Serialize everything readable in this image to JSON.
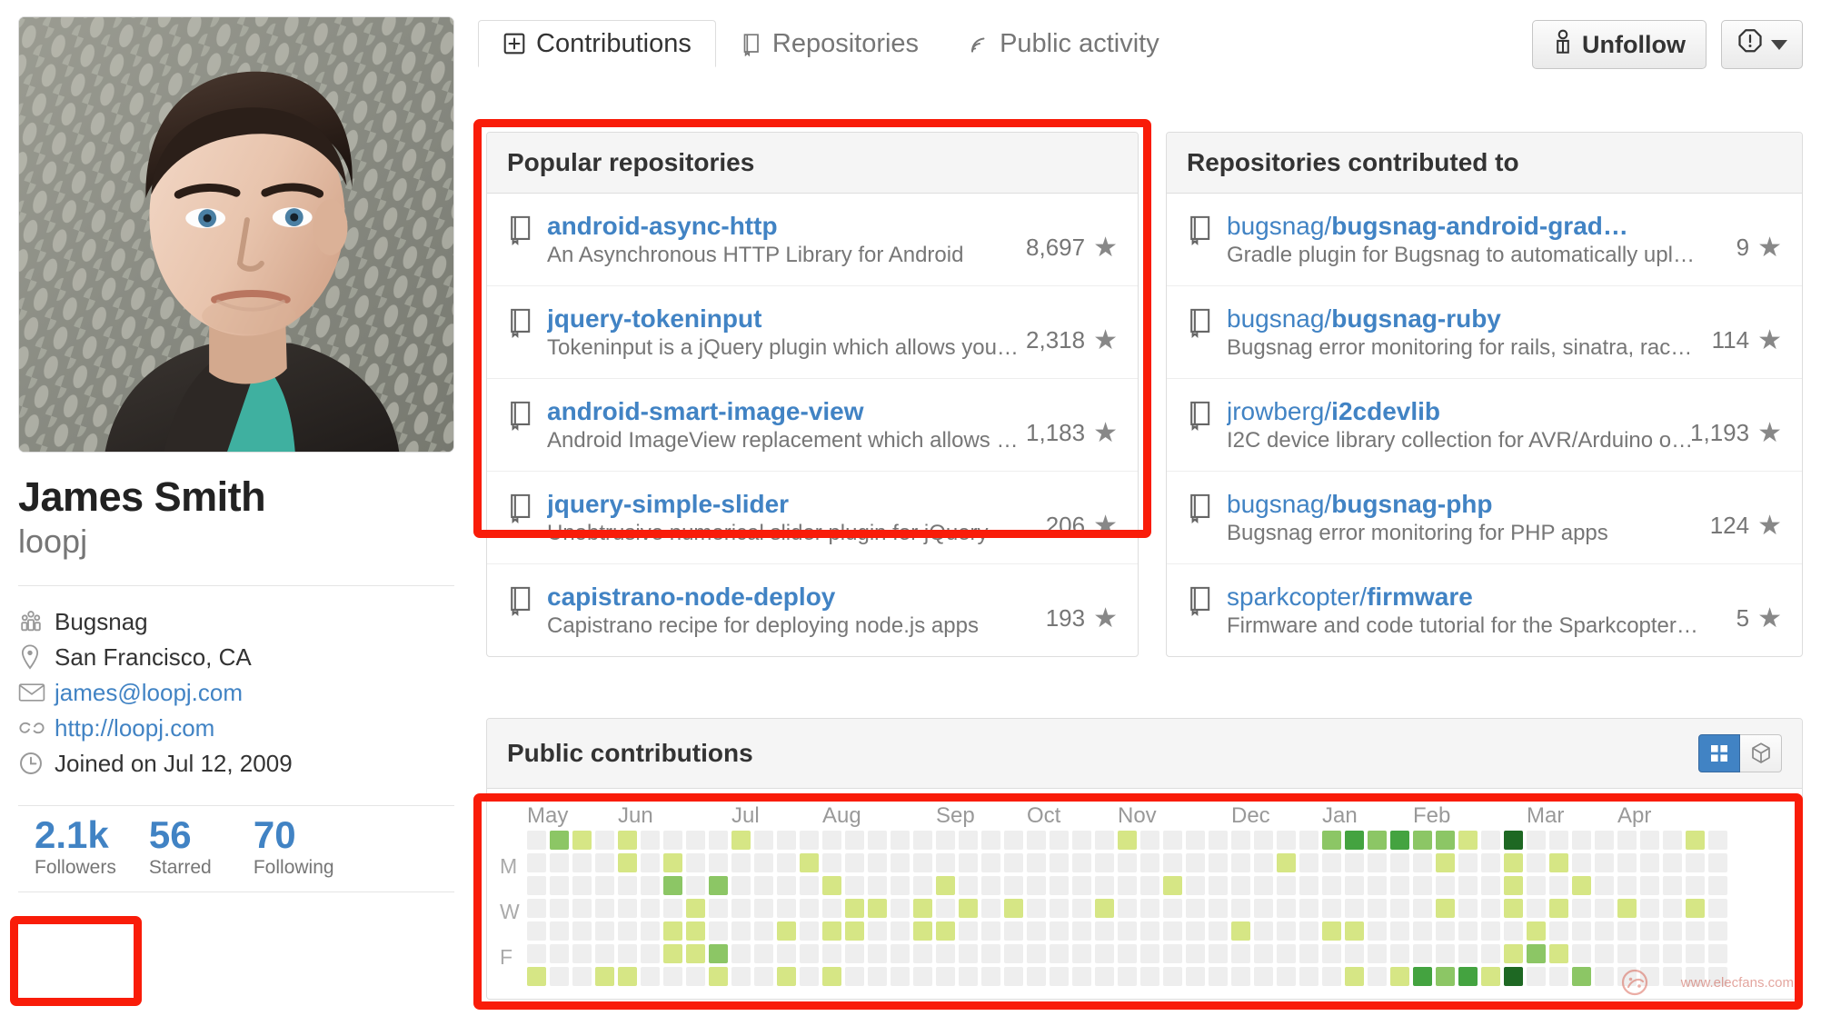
{
  "profile": {
    "avatar_alt": "avatar-photo",
    "fullname": "James Smith",
    "username": "loopj",
    "info": [
      {
        "icon": "organization-icon",
        "text": "Bugsnag",
        "link": false
      },
      {
        "icon": "location-pin-icon",
        "text": "San Francisco, CA",
        "link": false
      },
      {
        "icon": "mail-icon",
        "text": "james@loopj.com",
        "link": true
      },
      {
        "icon": "link-icon",
        "text": "http://loopj.com",
        "link": true
      },
      {
        "icon": "clock-icon",
        "text": "Joined on Jul 12, 2009",
        "link": false
      }
    ],
    "stats": [
      {
        "value": "2.1k",
        "label": "Followers"
      },
      {
        "value": "56",
        "label": "Starred"
      },
      {
        "value": "70",
        "label": "Following"
      }
    ]
  },
  "tabs": [
    {
      "label": "Contributions",
      "icon": "contributions-grid-icon",
      "active": true
    },
    {
      "label": "Repositories",
      "icon": "repo-book-icon",
      "active": false
    },
    {
      "label": "Public activity",
      "icon": "rss-feed-icon",
      "active": false
    }
  ],
  "actions": {
    "unfollow_label": "Unfollow",
    "unfollow_icon": "person-icon",
    "report_icon": "alert-octagon-icon",
    "report_caret": "chevron-down-icon"
  },
  "popular_repositories": {
    "title": "Popular repositories",
    "items": [
      {
        "owner": "",
        "name": "android-async-http",
        "description": "An Asynchronous HTTP Library for Android",
        "stars": "8,697"
      },
      {
        "owner": "",
        "name": "jquery-tokeninput",
        "description": "Tokeninput is a jQuery plugin which allows you…",
        "stars": "2,318"
      },
      {
        "owner": "",
        "name": "android-smart-image-view",
        "description": "Android ImageView replacement which allows …",
        "stars": "1,183"
      },
      {
        "owner": "",
        "name": "jquery-simple-slider",
        "description": "Unobtrusive numerical slider plugin for jQuery",
        "stars": "206"
      },
      {
        "owner": "",
        "name": "capistrano-node-deploy",
        "description": "Capistrano recipe for deploying node.js apps",
        "stars": "193"
      }
    ]
  },
  "contributed_repositories": {
    "title": "Repositories contributed to",
    "items": [
      {
        "owner": "bugsnag/",
        "name": "bugsnag-android-grad…",
        "description": "Gradle plugin for Bugsnag to automatically upl…",
        "stars": "9"
      },
      {
        "owner": "bugsnag/",
        "name": "bugsnag-ruby",
        "description": "Bugsnag error monitoring for rails, sinatra, rac…",
        "stars": "114"
      },
      {
        "owner": "jrowberg/",
        "name": "i2cdevlib",
        "description": "I2C device library collection for AVR/Arduino o…",
        "stars": "1,193"
      },
      {
        "owner": "bugsnag/",
        "name": "bugsnag-php",
        "description": "Bugsnag error monitoring for PHP apps",
        "stars": "124"
      },
      {
        "owner": "sparkcopter/",
        "name": "firmware",
        "description": "Firmware and code tutorial for the Sparkcopter…",
        "stars": "5"
      }
    ]
  },
  "public_contributions": {
    "title": "Public contributions",
    "view_toggle": [
      {
        "icon": "calendar-grid-icon",
        "active": true
      },
      {
        "icon": "cube-3d-icon",
        "active": false
      }
    ],
    "months": [
      "May",
      "Jun",
      "Jul",
      "Aug",
      "Sep",
      "Oct",
      "Nov",
      "Dec",
      "Jan",
      "Feb",
      "Mar",
      "Apr"
    ],
    "day_labels": [
      "M",
      "W",
      "F"
    ],
    "legend_colors": [
      "#eeeeee",
      "#d6e685",
      "#8cc665",
      "#44a340",
      "#1e6823"
    ]
  },
  "colors": {
    "accent_blue": "#4183c4",
    "annotation_red": "#f91c09",
    "text_dark": "#333333",
    "text_muted": "#767676"
  },
  "chart_data": {
    "type": "heatmap",
    "title": "Public contributions",
    "xlabel": "",
    "ylabel": "",
    "month_labels": [
      "May",
      "Jun",
      "Jul",
      "Aug",
      "Sep",
      "Oct",
      "Nov",
      "Dec",
      "Jan",
      "Feb",
      "Mar",
      "Apr"
    ],
    "month_start_weeks": [
      0,
      4,
      9,
      13,
      18,
      22,
      26,
      31,
      35,
      39,
      44,
      48
    ],
    "day_labels": [
      "",
      "M",
      "",
      "W",
      "",
      "F",
      ""
    ],
    "weeks": 53,
    "days_per_week": 7,
    "levels": [
      0,
      1,
      2,
      3,
      4
    ],
    "level_colors": [
      "#eeeeee",
      "#d6e685",
      "#8cc665",
      "#44a340",
      "#1e6823"
    ],
    "matrix": [
      [
        0,
        0,
        0,
        0,
        0,
        0,
        1
      ],
      [
        2,
        0,
        0,
        0,
        0,
        0,
        0
      ],
      [
        1,
        0,
        0,
        0,
        0,
        0,
        0
      ],
      [
        0,
        0,
        0,
        0,
        0,
        0,
        1
      ],
      [
        1,
        1,
        0,
        0,
        0,
        0,
        1
      ],
      [
        0,
        0,
        0,
        0,
        0,
        0,
        0
      ],
      [
        0,
        1,
        2,
        0,
        1,
        1,
        0
      ],
      [
        0,
        0,
        0,
        1,
        1,
        1,
        0
      ],
      [
        0,
        0,
        2,
        0,
        0,
        2,
        1
      ],
      [
        1,
        0,
        0,
        0,
        0,
        0,
        0
      ],
      [
        0,
        0,
        0,
        0,
        0,
        0,
        0
      ],
      [
        0,
        0,
        0,
        0,
        1,
        0,
        1
      ],
      [
        0,
        1,
        0,
        0,
        0,
        0,
        0
      ],
      [
        0,
        0,
        1,
        0,
        1,
        0,
        1
      ],
      [
        0,
        0,
        0,
        1,
        1,
        0,
        0
      ],
      [
        0,
        0,
        0,
        1,
        0,
        0,
        0
      ],
      [
        0,
        0,
        0,
        0,
        0,
        0,
        0
      ],
      [
        0,
        0,
        0,
        1,
        1,
        0,
        0
      ],
      [
        0,
        0,
        1,
        0,
        1,
        0,
        0
      ],
      [
        0,
        0,
        0,
        1,
        0,
        0,
        0
      ],
      [
        0,
        0,
        0,
        0,
        0,
        0,
        0
      ],
      [
        0,
        0,
        0,
        1,
        0,
        0,
        0
      ],
      [
        0,
        0,
        0,
        0,
        0,
        0,
        0
      ],
      [
        0,
        0,
        0,
        0,
        0,
        0,
        0
      ],
      [
        0,
        0,
        0,
        0,
        0,
        0,
        0
      ],
      [
        0,
        0,
        0,
        1,
        0,
        0,
        0
      ],
      [
        1,
        0,
        0,
        0,
        0,
        0,
        0
      ],
      [
        0,
        0,
        0,
        0,
        0,
        0,
        0
      ],
      [
        0,
        0,
        1,
        0,
        0,
        0,
        0
      ],
      [
        0,
        0,
        0,
        0,
        0,
        0,
        0
      ],
      [
        0,
        0,
        0,
        0,
        0,
        0,
        0
      ],
      [
        0,
        0,
        0,
        0,
        1,
        0,
        0
      ],
      [
        0,
        0,
        0,
        0,
        0,
        0,
        0
      ],
      [
        0,
        1,
        0,
        0,
        0,
        0,
        0
      ],
      [
        0,
        0,
        0,
        0,
        0,
        0,
        0
      ],
      [
        2,
        0,
        0,
        0,
        1,
        0,
        0
      ],
      [
        3,
        0,
        0,
        0,
        1,
        0,
        1
      ],
      [
        2,
        0,
        0,
        0,
        0,
        0,
        0
      ],
      [
        3,
        0,
        0,
        0,
        0,
        0,
        1
      ],
      [
        2,
        0,
        0,
        0,
        0,
        0,
        3
      ],
      [
        2,
        1,
        0,
        1,
        0,
        0,
        2
      ],
      [
        1,
        0,
        0,
        0,
        0,
        0,
        3
      ],
      [
        0,
        0,
        0,
        0,
        0,
        0,
        1
      ],
      [
        4,
        1,
        1,
        1,
        0,
        1,
        4
      ],
      [
        0,
        0,
        0,
        0,
        1,
        2,
        0
      ],
      [
        0,
        1,
        0,
        1,
        0,
        1,
        0
      ],
      [
        0,
        0,
        1,
        0,
        0,
        0,
        2
      ],
      [
        0,
        0,
        0,
        0,
        0,
        0,
        0
      ],
      [
        0,
        0,
        0,
        1,
        0,
        0,
        0
      ],
      [
        0,
        0,
        0,
        0,
        0,
        0,
        0
      ],
      [
        0,
        0,
        0,
        0,
        0,
        0,
        0
      ],
      [
        1,
        0,
        0,
        1,
        0,
        0,
        0
      ],
      [
        0,
        0,
        0,
        0,
        0,
        0,
        0
      ]
    ]
  }
}
